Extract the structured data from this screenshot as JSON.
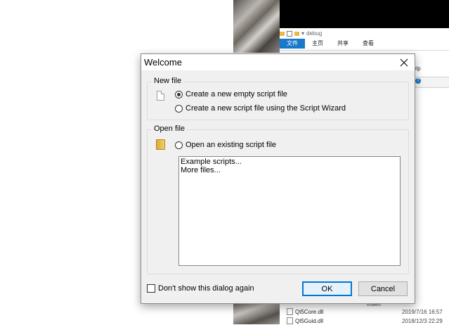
{
  "background": {
    "explorer": {
      "path": "debug",
      "tabs": [
        "文件",
        "主页",
        "共享",
        "查看"
      ],
      "help_text": "elp",
      "column_header": "Insert",
      "files": [
        {
          "name": "Qt5Core.dll",
          "date": "2019/7/16 16:57"
        },
        {
          "name": "Qt5Guid.dll",
          "date": "2018/12/3 22:29"
        }
      ]
    }
  },
  "dialog": {
    "title": "Welcome",
    "new_file": {
      "group_title": "New file",
      "option_empty": "Create a new empty script file",
      "option_wizard": "Create a new script file using the Script Wizard",
      "selected": "empty"
    },
    "open_file": {
      "group_title": "Open file",
      "option_existing": "Open an existing script file",
      "list_items": [
        "Example scripts...",
        "More files..."
      ]
    },
    "dont_show_label": "Don't show this dialog again",
    "dont_show_checked": false,
    "ok_label": "OK",
    "cancel_label": "Cancel"
  },
  "icons": {
    "close": "close-icon",
    "new_file": "document-icon",
    "open_file": "folder-icon"
  }
}
